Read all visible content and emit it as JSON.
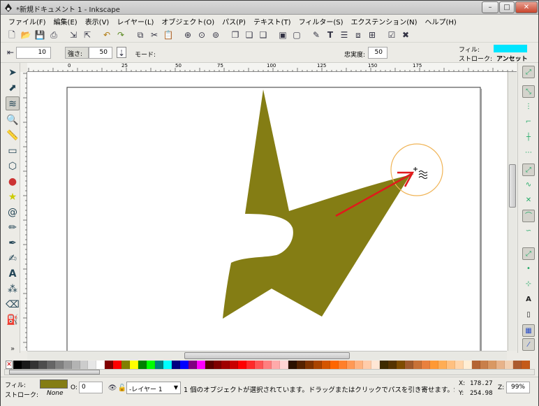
{
  "window": {
    "title": "*新規ドキュメント 1 - Inkscape",
    "btn_min": "–",
    "btn_max": "□",
    "btn_close": "✕"
  },
  "menu": [
    "ファイル(F)",
    "編集(E)",
    "表示(V)",
    "レイヤー(L)",
    "オブジェクト(O)",
    "パス(P)",
    "テキスト(T)",
    "フィルター(S)",
    "エクステンション(N)",
    "ヘルプ(H)"
  ],
  "tweak_controls": {
    "width_value": "10",
    "force_label": "強さ:",
    "force_value": "50",
    "mode_label": "モード:",
    "fidelity_label": "忠実度:",
    "fidelity_value": "50"
  },
  "style_indicator": {
    "fill_label": "フィル:",
    "stroke_label": "ストローク:",
    "stroke_value": "アンセット",
    "fill_color": "#00e5ff"
  },
  "ruler": {
    "labels": [
      "0",
      "25",
      "50",
      "75",
      "100",
      "125",
      "150",
      "175"
    ]
  },
  "canvas": {
    "shape_color": "#847d14",
    "cursor_circle_color": "#f0b456",
    "arrow_color": "#e0191b"
  },
  "palette": [
    "#000000",
    "#1a1a1a",
    "#333333",
    "#4d4d4d",
    "#666666",
    "#808080",
    "#999999",
    "#b3b3b3",
    "#cccccc",
    "#e6e6e6",
    "#ffffff",
    "#800000",
    "#ff0000",
    "#808000",
    "#ffff00",
    "#008000",
    "#00ff00",
    "#008080",
    "#00ffff",
    "#000080",
    "#0000ff",
    "#800080",
    "#ff00ff",
    "#5a0000",
    "#7f0000",
    "#a00000",
    "#c80000",
    "#ff0000",
    "#ff2a2a",
    "#ff5555",
    "#ff7f7f",
    "#ffaaaa",
    "#ffd5d5",
    "#2b1100",
    "#552200",
    "#803300",
    "#aa4400",
    "#d45500",
    "#ff6600",
    "#ff7f2a",
    "#ff9955",
    "#ffb380",
    "#ffccaa",
    "#ffe6d5",
    "#3d2a00",
    "#553300",
    "#7f4c00",
    "#a05a2c",
    "#c87137",
    "#e9803e",
    "#ff9933",
    "#ffad55",
    "#ffc080",
    "#ffd5aa",
    "#ffeed5",
    "#b46433",
    "#c87f4a",
    "#d99863",
    "#e8b38a",
    "#f2d0b2",
    "#ac5a2d",
    "#c45a1a"
  ],
  "status": {
    "fill_label": "フィル:",
    "fill_swatch": "#847d14",
    "stroke_label": "ストローク:",
    "stroke_value": "None",
    "opacity_label": "O:",
    "opacity_value": "0",
    "layer_name": "-レイヤー 1",
    "message": "1 個のオブジェクトが選択されています。ドラッグまたはクリックでパスを引き寄せます。Shif",
    "x_label": "X:",
    "x_value": "178.27",
    "y_label": "Y:",
    "y_value": "254.98",
    "zoom_label": "Z:",
    "zoom_value": "99%"
  }
}
